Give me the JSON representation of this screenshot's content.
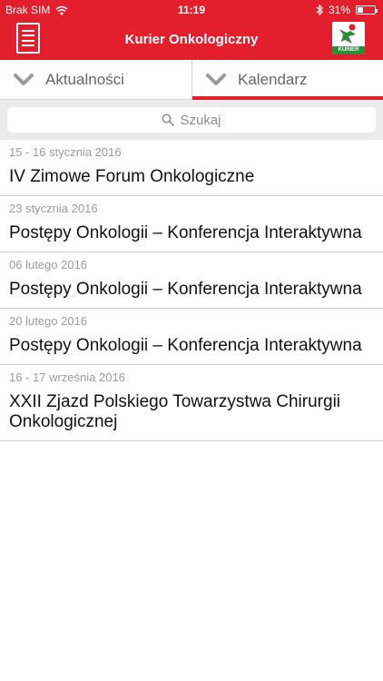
{
  "statusbar": {
    "carrier": "Brak SIM",
    "time": "11:19",
    "battery_percent": "31%",
    "battery_level": 0.31,
    "icons": [
      "wifi-icon",
      "bluetooth-icon",
      "battery-icon"
    ]
  },
  "navbar": {
    "title": "Kurier Onkologiczny",
    "menu_icon": "hamburger-menu-icon",
    "logo_text": "KURIER"
  },
  "tabs": [
    {
      "label": "Aktualności",
      "active": false,
      "icon": "chevron-down-icon"
    },
    {
      "label": "Kalendarz",
      "active": true,
      "icon": "chevron-down-icon"
    }
  ],
  "search": {
    "placeholder": "Szukaj",
    "icon": "search-icon"
  },
  "events": [
    {
      "date": "15 - 16 stycznia 2016",
      "title": "IV Zimowe Forum Onkologiczne"
    },
    {
      "date": "23 stycznia 2016",
      "title": "Postępy Onkologii – Konferencja Interaktywna"
    },
    {
      "date": "06 lutego 2016",
      "title": "Postępy Onkologii – Konferencja Interaktywna"
    },
    {
      "date": "20 lutego 2016",
      "title": "Postępy Onkologii – Konferencja Interaktywna"
    },
    {
      "date": "16 - 17 września 2016",
      "title": "XXII Zjazd Polskiego Towarzystwa Chirurgii Onkologicznej"
    }
  ],
  "colors": {
    "brand_red": "#e41f2d",
    "logo_green": "#2e8b3a",
    "tab_text": "#666666",
    "date_text": "#9b9b9b"
  }
}
